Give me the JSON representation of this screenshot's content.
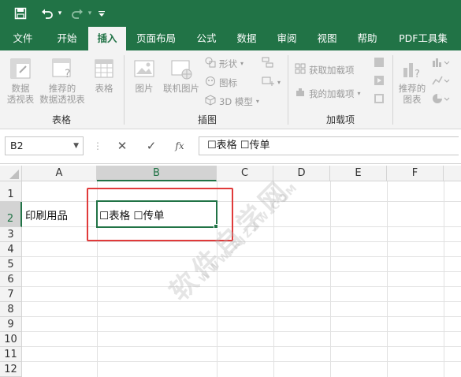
{
  "qat": {
    "save_icon": "save-icon",
    "undo_icon": "undo-icon",
    "redo_icon": "redo-icon",
    "customize_icon": "customize-icon"
  },
  "tabs": [
    "文件",
    "开始",
    "插入",
    "页面布局",
    "公式",
    "数据",
    "审阅",
    "视图",
    "帮助",
    "PDF工具集"
  ],
  "active_tab": "插入",
  "ribbon": {
    "tables_group": {
      "label": "表格",
      "pivot": "数据\n透视表",
      "rec_pivot": "推荐的\n数据透视表",
      "table": "表格"
    },
    "illustrations_group": {
      "label": "插图",
      "picture": "图片",
      "online_picture": "联机图片",
      "shapes": "形状",
      "icons": "图标",
      "model3d": "3D 模型"
    },
    "addins_group": {
      "label": "加载项",
      "get_addins": "获取加载项",
      "my_addins": "我的加载项"
    },
    "charts": {
      "rec_charts": "推荐的\n图表"
    }
  },
  "formula_bar": {
    "name_box": "B2",
    "cancel": "✕",
    "enter": "✓",
    "fx": "fx",
    "content": "☐表格  ☐传单"
  },
  "grid": {
    "columns": [
      "A",
      "B",
      "C",
      "D",
      "E",
      "F"
    ],
    "selected_column": "B",
    "rows": [
      "1",
      "2",
      "3",
      "4",
      "5",
      "6",
      "7",
      "8",
      "9",
      "10",
      "11",
      "12"
    ],
    "selected_row": "2",
    "cells": {
      "A2": "印刷用品",
      "B2": "☐表格  ☐传单"
    }
  },
  "watermark": "软件自学网",
  "watermark_url": "WWW.RJZXW.COM",
  "colors": {
    "excel_green": "#217346",
    "highlight_red": "#e03a3a"
  }
}
